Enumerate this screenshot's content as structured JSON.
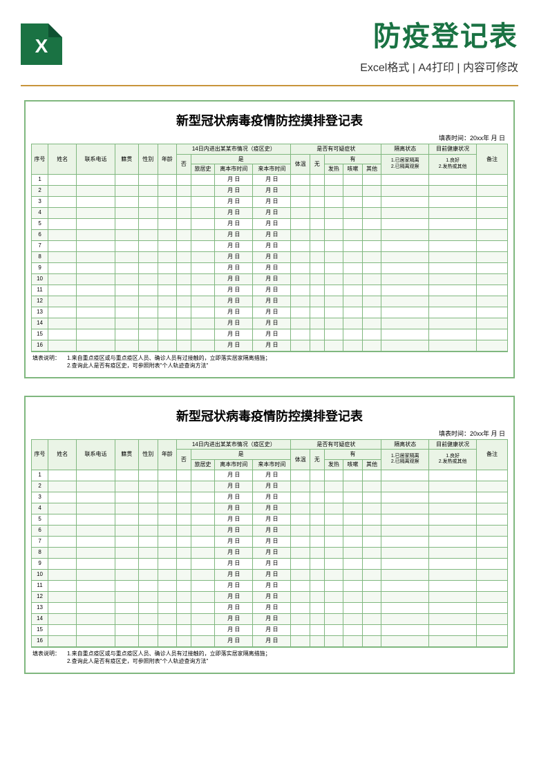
{
  "header": {
    "main_title": "防疫登记表",
    "sub_title": "Excel格式 | A4打印 | 内容可修改"
  },
  "sheet": {
    "title": "新型冠状病毒疫情防控摸排登记表",
    "fill_time": "填表时间：20xx年  月  日",
    "columns": {
      "seq": "序号",
      "name": "姓名",
      "phone": "联系电话",
      "origin": "籍贯",
      "gender": "性别",
      "age": "年龄",
      "travel_group": "14日内进出某某市情况（疫区史）",
      "no": "否",
      "yes": "是",
      "travel_history": "旅居史",
      "leave_time": "离本市时间",
      "arrive_time": "来本市时间",
      "symptom_group": "是否有可疑症状",
      "temp": "体温",
      "none": "无",
      "has": "有",
      "fever": "发热",
      "cough": "咳嗽",
      "other": "其他",
      "isolation": "隔离状态",
      "iso_opts": "1.已居家隔离\n2.已隔离观察",
      "health": "目前健康状况",
      "health_opts": "1.良好\n2.发热或其他",
      "remark": "备注"
    },
    "date_cell": "月  日",
    "row_count": 16,
    "notes_label": "填表说明：",
    "notes": [
      "1.来自重点疫区或与重点疫区人员、确诊人员有过接触的，立即落实居家隔离措施；",
      "2.查询此人是否有疫区史，可参照附表\"个人轨迹查询方法\""
    ]
  }
}
